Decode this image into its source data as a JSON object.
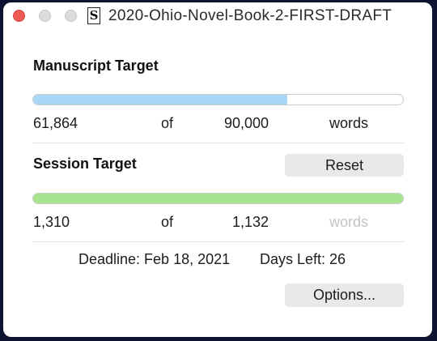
{
  "window": {
    "title": "2020-Ohio-Novel-Book-2-FIRST-DRAFT",
    "doc_icon_glyph": "S",
    "traffic_lights": [
      "close",
      "minimize",
      "zoom"
    ]
  },
  "manuscript": {
    "heading": "Manuscript Target",
    "current": "61,864",
    "of_label": "of",
    "target": "90,000",
    "unit": "words",
    "progress_fraction": 0.687,
    "bar_color": "#a9d6f5"
  },
  "session": {
    "heading": "Session Target",
    "reset_label": "Reset",
    "current": "1,310",
    "of_label": "of",
    "target": "1,132",
    "unit": "words",
    "progress_fraction": 1.0,
    "bar_color": "#a6e48f"
  },
  "footer": {
    "deadline": "Deadline: Feb 18, 2021",
    "days_left": "Days Left: 26",
    "options_label": "Options..."
  },
  "colors": {
    "close_light": "#ee5a53",
    "inactive_light": "#dcdcdc",
    "background": "#0d1431"
  }
}
